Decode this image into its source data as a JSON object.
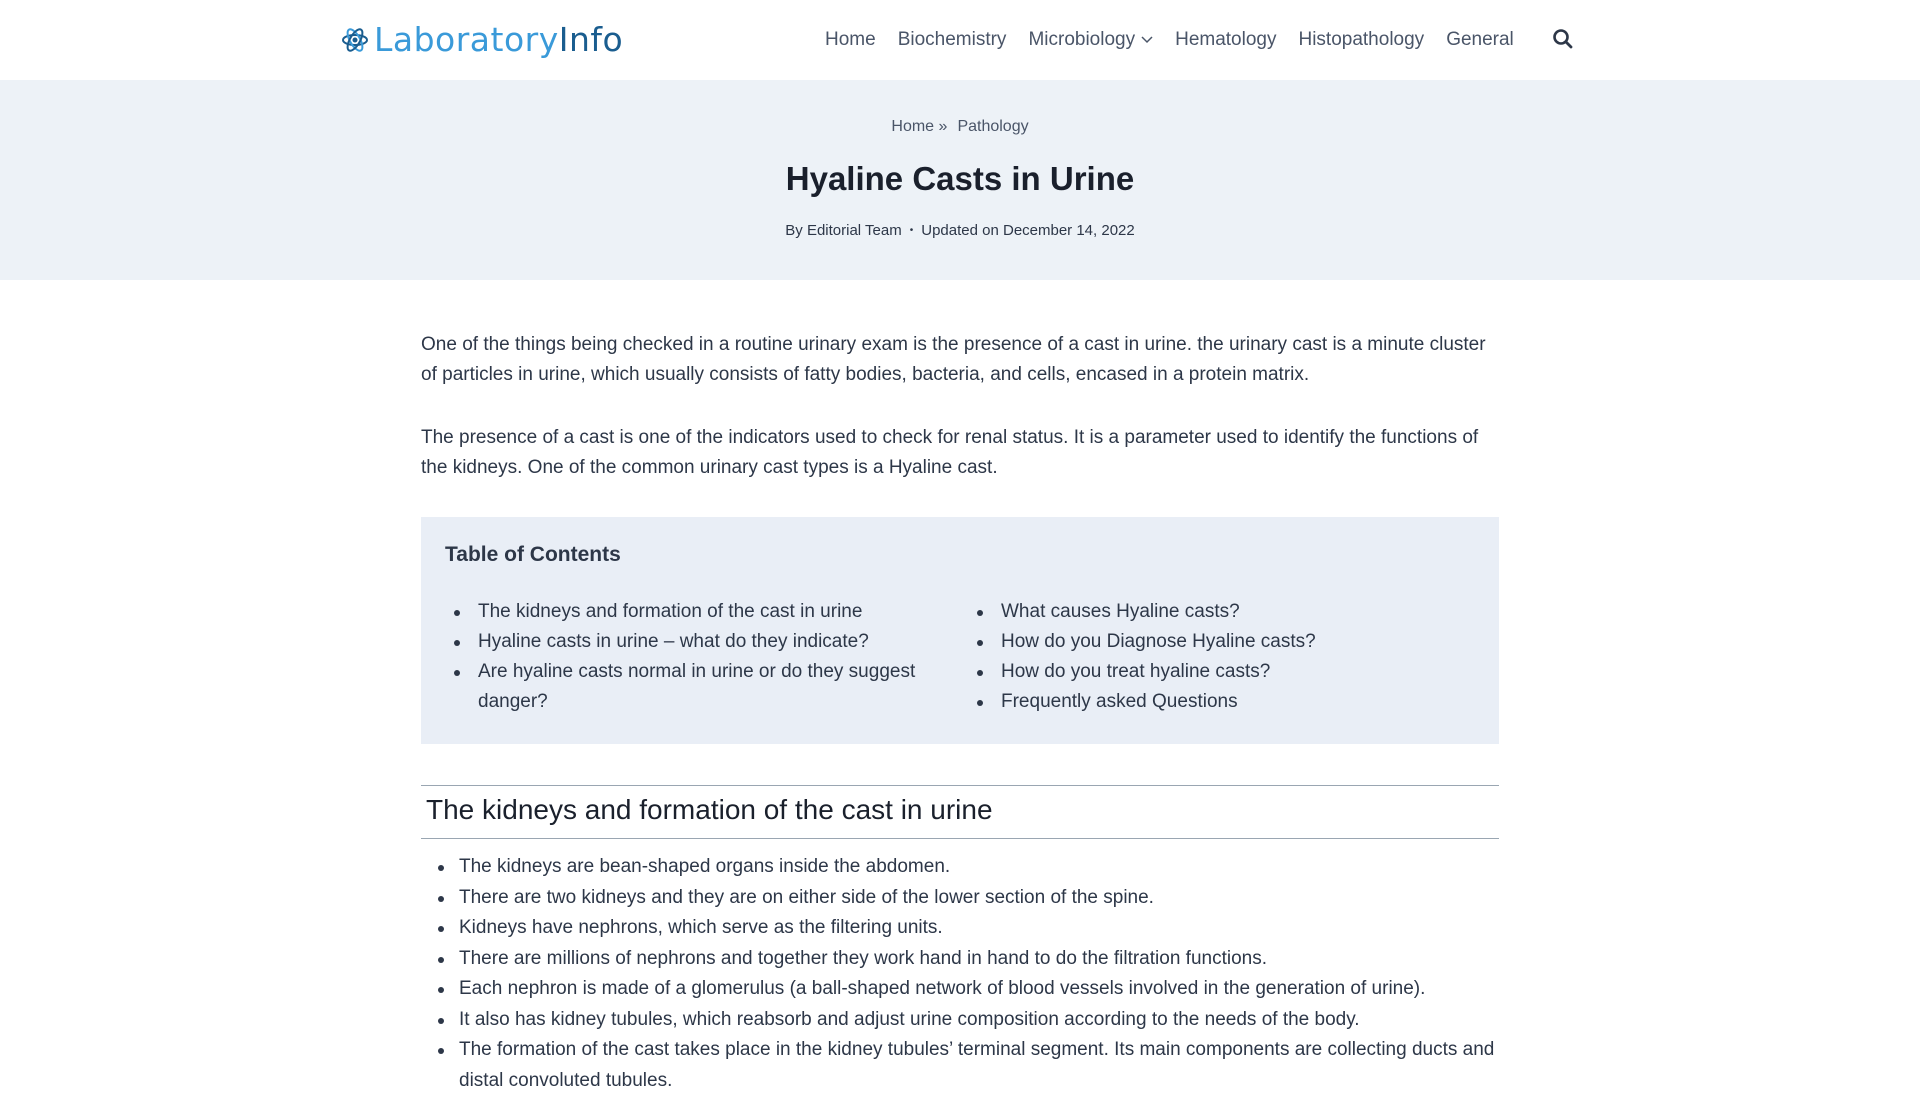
{
  "brand": {
    "logo_part1": "Laboratory",
    "logo_part2": "Info"
  },
  "nav": {
    "items": [
      "Home",
      "Biochemistry",
      "Microbiology",
      "Hematology",
      "Histopathology",
      "General"
    ],
    "search_icon": "search-icon",
    "dropdown_icon": "chevron-down-icon"
  },
  "breadcrumb": {
    "home": "Home",
    "separator": "»",
    "current": "Pathology"
  },
  "article": {
    "title": "Hyaline Casts in Urine",
    "by_prefix": "By",
    "author": "Editorial Team",
    "dot": "•",
    "updated_prefix": "Updated on",
    "updated_date": "December 14, 2022",
    "paragraph1": "One of the things being checked in a routine urinary exam is the presence of a cast in urine. the urinary cast is a minute cluster of particles in urine, which usually consists of fatty bodies, bacteria, and cells, encased in a protein matrix.",
    "paragraph2": "The presence of a cast is one of the indicators used to check for renal status. It is a parameter used to identify the functions of the kidneys. One of the common urinary cast types is a Hyaline cast."
  },
  "toc": {
    "title": "Table of Contents",
    "col1": [
      "The kidneys and formation of the cast in urine",
      "Hyaline casts in urine – what do they indicate?",
      "Are hyaline casts normal in urine or do they suggest danger?"
    ],
    "col2": [
      "What causes Hyaline casts?",
      "How do you Diagnose Hyaline casts?",
      "How do you treat hyaline casts?",
      "Frequently asked Questions"
    ]
  },
  "section1": {
    "heading": "The kidneys and formation of the cast in urine",
    "bullets": [
      "The kidneys are bean-shaped organs inside the abdomen.",
      "There are two kidneys and they are on either side of the lower section of the spine.",
      "Kidneys have nephrons, which serve as the filtering units.",
      "There are millions of nephrons and together they work hand in hand to do the filtration functions.",
      "Each nephron is made of a glomerulus (a ball-shaped network of blood vessels involved in the generation of urine).",
      "It also has kidney tubules, which reabsorb and adjust urine composition according to the needs of the body.",
      "The formation of the cast takes place in the kidney tubules’ terminal segment. Its main components are collecting ducts and distal convoluted tubules."
    ]
  },
  "colors": {
    "hero_bg": "#edf2f7",
    "toc_bg": "#e9eef6",
    "logo_light": "#3a9ad9",
    "logo_dark": "#1a5d8f"
  }
}
